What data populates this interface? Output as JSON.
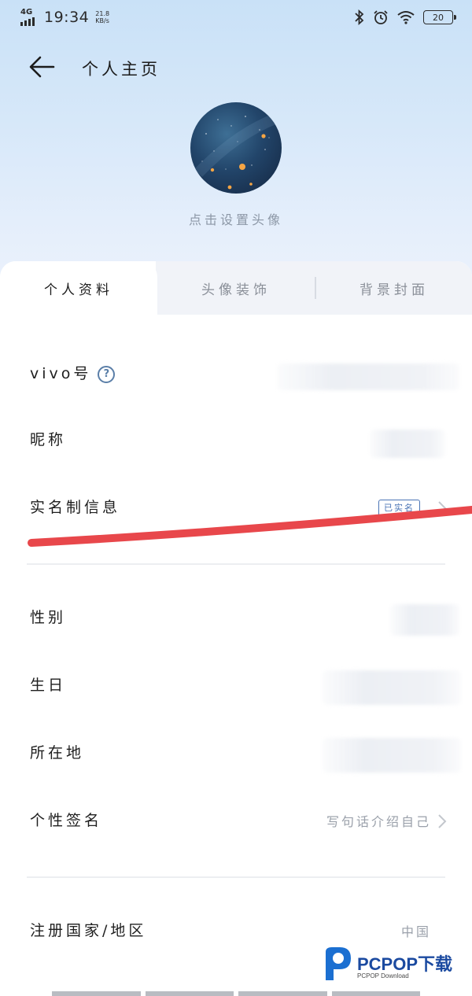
{
  "status_bar": {
    "network": "4G",
    "time": "19:34",
    "speed_value": "21.8",
    "speed_unit": "KB/s",
    "battery": "20"
  },
  "header": {
    "title": "个人主页"
  },
  "avatar": {
    "hint": "点击设置头像"
  },
  "tabs": [
    {
      "label": "个人资料",
      "active": true
    },
    {
      "label": "头像装饰",
      "active": false
    },
    {
      "label": "背景封面",
      "active": false
    }
  ],
  "rows": {
    "vivo_id": {
      "label": "vivo号",
      "help": "?"
    },
    "nickname": {
      "label": "昵称"
    },
    "realname": {
      "label": "实名制信息",
      "badge": "已实名"
    },
    "gender": {
      "label": "性别"
    },
    "birthday": {
      "label": "生日"
    },
    "location": {
      "label": "所在地"
    },
    "signature": {
      "label": "个性签名",
      "value": "写句话介绍自己"
    },
    "region": {
      "label": "注册国家/地区",
      "value": "中国"
    }
  },
  "watermark": {
    "brand": "PCPOP下载",
    "sub": "PCPOP Download"
  },
  "colors": {
    "accent": "#4a74b5",
    "annotation_line": "#e8474b",
    "hero_top": "#c9e1f7"
  }
}
